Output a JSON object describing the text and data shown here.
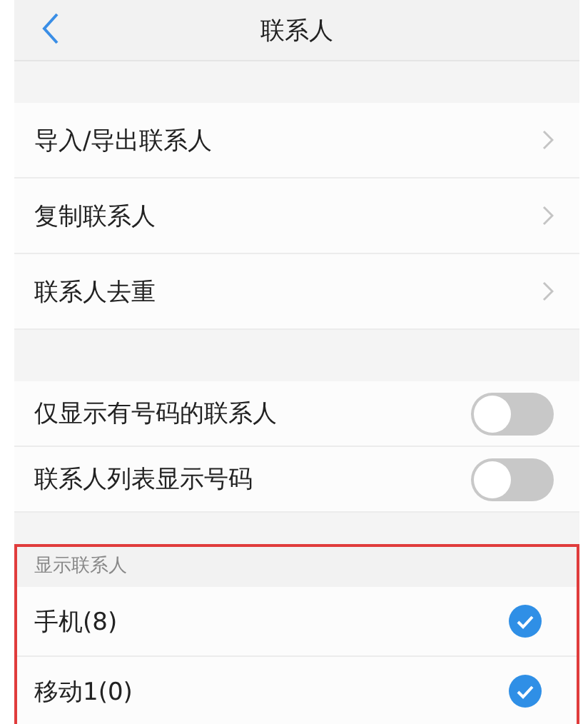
{
  "nav_bar": {
    "title": "联系人"
  },
  "menu_items": [
    {
      "label": "导入/导出联系人"
    },
    {
      "label": "复制联系人"
    },
    {
      "label": "联系人去重"
    }
  ],
  "toggles": [
    {
      "label": "仅显示有号码的联系人",
      "on": false
    },
    {
      "label": "联系人列表显示号码",
      "on": false
    }
  ],
  "display_section": {
    "header": "显示联系人",
    "highlighted": true,
    "accounts": [
      {
        "label": "手机(8)",
        "checked": true
      },
      {
        "label": "移动1(0)",
        "checked": true
      }
    ]
  }
}
